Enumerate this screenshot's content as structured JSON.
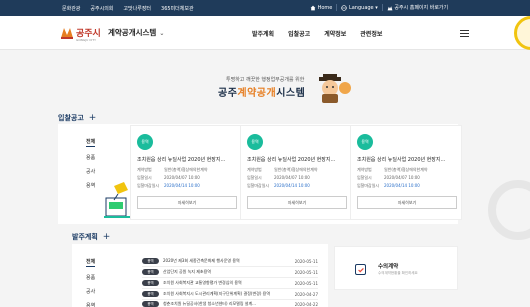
{
  "topbar": {
    "links": [
      "문화관광",
      "공주시의회",
      "고맛나루장터",
      "365미더체보관"
    ],
    "home": "Home",
    "language": "Language",
    "shortcut": "공주시 홈페이지 바로가기"
  },
  "header": {
    "logo_text": "공주시",
    "logo_sub": "GONGJU CITY",
    "system_title": "계약공개시스템",
    "nav": [
      "발주계획",
      "입찰공고",
      "계약정보",
      "관련정보"
    ]
  },
  "banner": {
    "subtitle": "투명하고 깨끗한 행정업무공개를 위한",
    "title_a": "공주",
    "title_hl": "계약공개",
    "title_b": "시스템"
  },
  "tender_section": {
    "heading": "입찰공고",
    "tabs": [
      "전체",
      "용품",
      "공사",
      "용역"
    ],
    "cards": [
      {
        "badge": "용역",
        "title": "조치원읍 상리 뉴딜사업 2020년 현장지...",
        "rows": [
          {
            "k": "계약방법",
            "v": "일반(총액)협상에의한계약"
          },
          {
            "k": "입찰일시",
            "v": "2020/04/07 10:00"
          },
          {
            "k": "입찰마감일시",
            "v": "2020/04/14 10:00"
          }
        ],
        "button": "자세히보기"
      },
      {
        "badge": "용역",
        "title": "조치원읍 상리 뉴딜사업 2020년 현장지...",
        "rows": [
          {
            "k": "계약방법",
            "v": "일반(총액)협상에의한계약"
          },
          {
            "k": "입찰일시",
            "v": "2020/04/07 10:00"
          },
          {
            "k": "입찰마감일시",
            "v": "2020/04/14 10:00"
          }
        ],
        "button": "자세히보기"
      },
      {
        "badge": "용역",
        "title": "조치원읍 상리 뉴딜사업 2020년 현장지...",
        "rows": [
          {
            "k": "계약방법",
            "v": "일반(총액)협상에의한계약"
          },
          {
            "k": "입찰일시",
            "v": "2020/04/07 10:00"
          },
          {
            "k": "입찰마감일시",
            "v": "2020/04/14 10:00"
          }
        ],
        "button": "자세히보기"
      }
    ]
  },
  "plan_section": {
    "heading": "발주계획",
    "tabs": [
      "전체",
      "용품",
      "공사",
      "용역"
    ],
    "rows": [
      {
        "tag": "용역",
        "title": "2020년 제3회 세종건축문화제 행사운영 용역",
        "date": "2020-05-11"
      },
      {
        "tag": "용역",
        "title": "산업단지 공원 녹지 제초용역",
        "date": "2020-05-11"
      },
      {
        "tag": "용역",
        "title": "조치원 사회복지관 교통영향평가 변경심의 용역",
        "date": "2020-05-11"
      },
      {
        "tag": "용역",
        "title": "조치원 사회복지시 도시관리계획(지구단위계획) 결정(변경) 용역",
        "date": "2020-04-27"
      },
      {
        "tag": "용역",
        "title": "청춘조치원 뉴딜공사(한생 청소년센터) 리모델링 설계...",
        "date": "2020-04-22"
      }
    ]
  },
  "contract_card": {
    "title": "수의계약",
    "subtitle": "수의계약현황을 확인하세요"
  }
}
